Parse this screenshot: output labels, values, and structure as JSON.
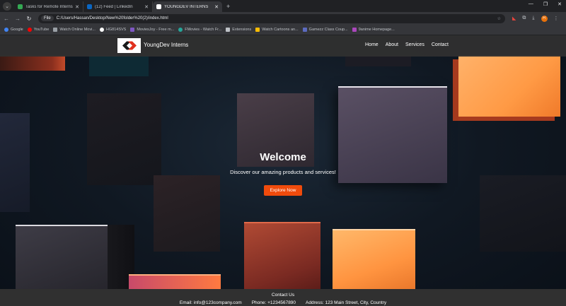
{
  "browser": {
    "tabs": [
      {
        "label": "Tasks for Remote Internships",
        "favicon_color": "#34a853",
        "active": false
      },
      {
        "label": "(12) Feed | LinkedIn",
        "favicon_color": "#0a66c2",
        "active": false
      },
      {
        "label": "YOUNGDEV INTERNS",
        "favicon_color": "#ffffff",
        "active": true
      }
    ],
    "omnibox": {
      "chip": "File",
      "url": "C:/Users/Hassan/Desktop/New%20folder%20(2)/index.html"
    },
    "bookmarks": [
      {
        "label": "Google",
        "color": "#4285f4"
      },
      {
        "label": "YouTube",
        "color": "#ff0000"
      },
      {
        "label": "Watch Online Movi...",
        "color": "#9aa0a6"
      },
      {
        "label": "HG814SVS",
        "color": "#ffffff"
      },
      {
        "label": "MoviesJoy - Free m...",
        "color": "#7e57c2"
      },
      {
        "label": "FMovies - Watch Fr...",
        "color": "#26a69a"
      },
      {
        "label": "Extensions",
        "color": "#bdc1c6"
      },
      {
        "label": "Watch Cartoons an...",
        "color": "#fbbc04"
      },
      {
        "label": "Gamezz Class Coup...",
        "color": "#5c6bc0"
      },
      {
        "label": "9anime Homepage...",
        "color": "#ab47bc"
      }
    ]
  },
  "site": {
    "brand": "YoungDev Interns",
    "nav": [
      "Home",
      "About",
      "Services",
      "Contact"
    ],
    "hero": {
      "title": "Welcome",
      "subtitle": "Discover our amazing products and services!",
      "cta": "Explore Now"
    },
    "footer": {
      "heading": "Contact Us",
      "email": "Email: info@123company.com",
      "phone": "Phone: +1234567890",
      "address": "Address: 123 Main Street, City, Country"
    },
    "colors": {
      "accent": "#f04b0c",
      "navbar": "#303030"
    }
  }
}
